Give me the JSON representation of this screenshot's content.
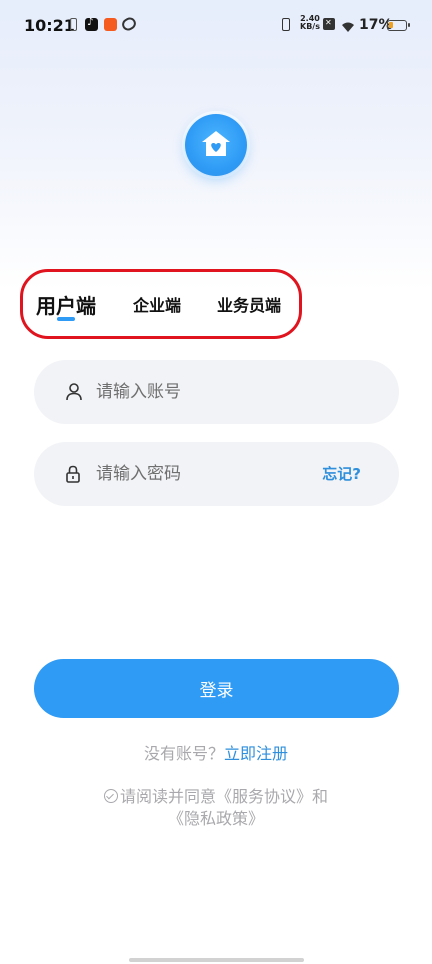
{
  "status_bar": {
    "time": "10:21",
    "net_speed_value": "2.40",
    "net_speed_unit": "KB/s",
    "battery_percent": "17%",
    "battery_color": "#f0a020"
  },
  "tabs": [
    {
      "label": "用户端",
      "selected": true
    },
    {
      "label": "企业端",
      "selected": false
    },
    {
      "label": "业务员端",
      "selected": false
    }
  ],
  "form": {
    "account_placeholder": "请输入账号",
    "password_placeholder": "请输入密码",
    "forgot_label": "忘记?",
    "account_icon": "user-icon",
    "password_icon": "lock-icon"
  },
  "login_label": "登录",
  "register": {
    "prompt": "没有账号？",
    "link": "立即注册"
  },
  "agreement": {
    "prefix": "请阅读并同意",
    "service_link": "《服务协议》",
    "conjunction": "和",
    "privacy_link": "《隐私政策》"
  },
  "colors": {
    "accent": "#2f9bf5",
    "link": "#2f8fdc",
    "highlight_border": "#e0141e",
    "muted_text": "#a9a9ad"
  }
}
